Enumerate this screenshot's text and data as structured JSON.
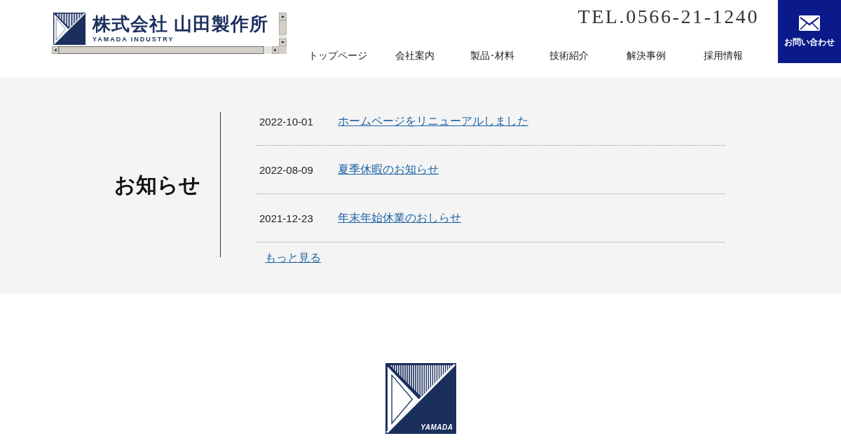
{
  "header": {
    "logo": {
      "company_name": "株式会社 山田製作所",
      "tagline": "YAMADA INDUSTRY"
    },
    "phone": "TEL.0566-21-1240",
    "contact_button": {
      "label": "お問い合わせ"
    },
    "nav": [
      {
        "label": "トップページ"
      },
      {
        "label": "会社案内"
      },
      {
        "label": "製品･材料"
      },
      {
        "label": "技術紹介"
      },
      {
        "label": "解決事例"
      },
      {
        "label": "採用情報"
      }
    ]
  },
  "news": {
    "title": "お知らせ",
    "items": [
      {
        "date": "2022-10-01",
        "title": "ホームページをリニューアルしました"
      },
      {
        "date": "2022-08-09",
        "title": "夏季休暇のお知らせ"
      },
      {
        "date": "2021-12-23",
        "title": "年末年始休業のおしらせ"
      }
    ],
    "more_link": "もっと見る"
  },
  "footer": {
    "logo_text": "YAMADA"
  }
}
